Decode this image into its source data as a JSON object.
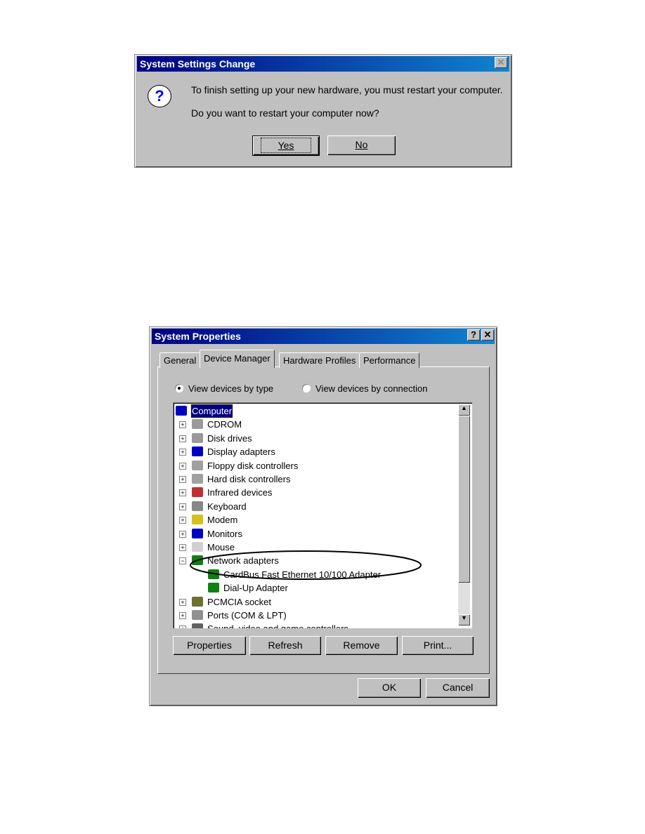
{
  "dialog1": {
    "title": "System Settings Change",
    "icon": "question-icon",
    "message1": "To finish setting up your new hardware, you must restart your computer.",
    "message2": "Do you want to restart your computer now?",
    "yes_label": "Yes",
    "no_label": "No"
  },
  "dialog2": {
    "title": "System Properties",
    "help_label": "?",
    "close_label": "✕",
    "tabs": [
      "General",
      "Device Manager",
      "Hardware Profiles",
      "Performance"
    ],
    "active_tab": "Device Manager",
    "radio_type": "View devices by type",
    "radio_connection": "View devices by connection",
    "selected_view": "type",
    "tree": [
      {
        "label": "Computer",
        "level": 0,
        "icon": "computer-icon",
        "selected": true
      },
      {
        "label": "CDROM",
        "level": 1,
        "icon": "cdrom-icon",
        "expander": "+"
      },
      {
        "label": "Disk drives",
        "level": 1,
        "icon": "disk-drive-icon",
        "expander": "+"
      },
      {
        "label": "Display adapters",
        "level": 1,
        "icon": "display-icon",
        "expander": "+"
      },
      {
        "label": "Floppy disk controllers",
        "level": 1,
        "icon": "controller-icon",
        "expander": "+"
      },
      {
        "label": "Hard disk controllers",
        "level": 1,
        "icon": "controller-icon",
        "expander": "+"
      },
      {
        "label": "Infrared devices",
        "level": 1,
        "icon": "infrared-icon",
        "expander": "+"
      },
      {
        "label": "Keyboard",
        "level": 1,
        "icon": "keyboard-icon",
        "expander": "+"
      },
      {
        "label": "Modem",
        "level": 1,
        "icon": "modem-icon",
        "expander": "+"
      },
      {
        "label": "Monitors",
        "level": 1,
        "icon": "monitor-icon",
        "expander": "+"
      },
      {
        "label": "Mouse",
        "level": 1,
        "icon": "mouse-icon",
        "expander": "+"
      },
      {
        "label": "Network adapters",
        "level": 1,
        "icon": "network-card-icon",
        "expander": "−"
      },
      {
        "label": "CardBus Fast Ethernet 10/100 Adapter",
        "level": 2,
        "icon": "network-card-icon",
        "highlighted": true
      },
      {
        "label": "Dial-Up Adapter",
        "level": 2,
        "icon": "network-card-icon"
      },
      {
        "label": "PCMCIA socket",
        "level": 1,
        "icon": "pcmcia-icon",
        "expander": "+"
      },
      {
        "label": "Ports (COM & LPT)",
        "level": 1,
        "icon": "port-icon",
        "expander": "+"
      },
      {
        "label": "Sound, video and game controllers",
        "level": 1,
        "icon": "sound-icon",
        "expander": "+"
      }
    ],
    "buttons": {
      "properties": "Properties",
      "refresh": "Refresh",
      "remove": "Remove",
      "print": "Print...",
      "ok": "OK",
      "cancel": "Cancel"
    }
  },
  "colors": {
    "titlebar": "#000080",
    "face": "#c0c0c0",
    "highlight_ellipse": "#000000"
  }
}
